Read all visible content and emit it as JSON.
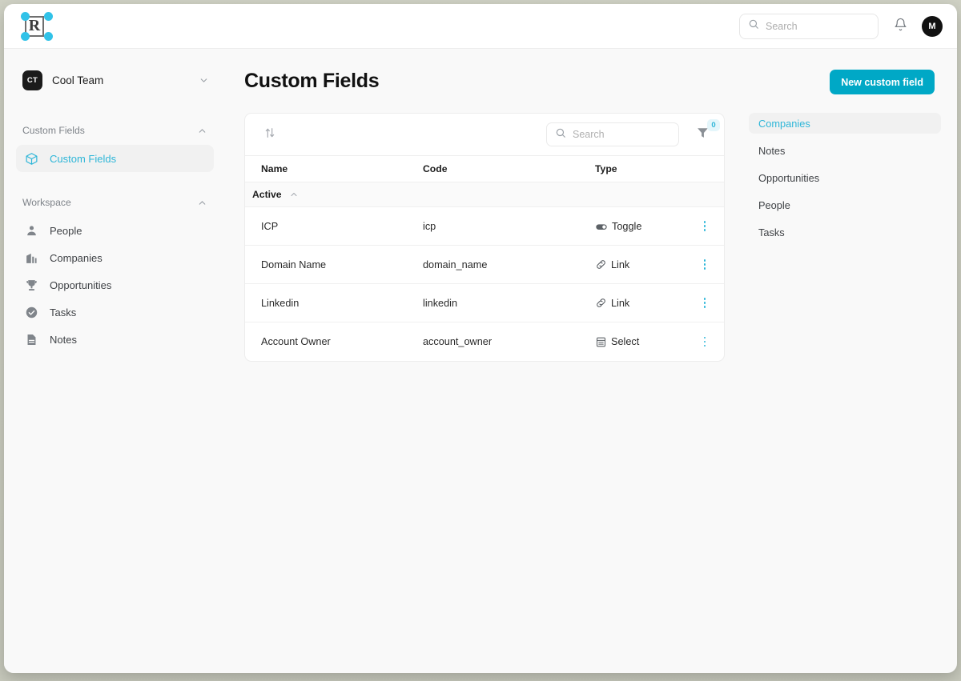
{
  "topbar": {
    "logo_letter": "R",
    "search": {
      "placeholder": "Search",
      "value": ""
    },
    "notification_icon": "bell-icon",
    "avatar_initial": "M"
  },
  "sidebar": {
    "workspace": {
      "badge": "CT",
      "name": "Cool Team"
    },
    "sections": [
      {
        "title": "Custom Fields",
        "items": [
          {
            "label": "Custom Fields",
            "icon": "cube-icon",
            "active": true
          }
        ]
      },
      {
        "title": "Workspace",
        "items": [
          {
            "label": "People",
            "icon": "person-icon",
            "active": false
          },
          {
            "label": "Companies",
            "icon": "building-icon",
            "active": false
          },
          {
            "label": "Opportunities",
            "icon": "trophy-icon",
            "active": false
          },
          {
            "label": "Tasks",
            "icon": "check-circle-icon",
            "active": false
          },
          {
            "label": "Notes",
            "icon": "note-icon",
            "active": false
          }
        ]
      }
    ]
  },
  "main": {
    "title": "Custom Fields",
    "new_button": "New custom field",
    "toolbar": {
      "sort_icon": "sort-icon",
      "search": {
        "placeholder": "Search",
        "value": ""
      },
      "filter_icon": "filter-icon",
      "filter_count": "0"
    },
    "table": {
      "columns": [
        "Name",
        "Code",
        "Type"
      ],
      "groups": [
        {
          "label": "Active",
          "rows": [
            {
              "name": "ICP",
              "code": "icp",
              "type": "Toggle",
              "type_icon": "toggle-icon"
            },
            {
              "name": "Domain Name",
              "code": "domain_name",
              "type": "Link",
              "type_icon": "link-icon"
            },
            {
              "name": "Linkedin",
              "code": "linkedin",
              "type": "Link",
              "type_icon": "link-icon"
            },
            {
              "name": "Account Owner",
              "code": "account_owner",
              "type": "Select",
              "type_icon": "select-icon"
            }
          ]
        }
      ]
    },
    "object_list": [
      {
        "label": "Companies",
        "active": true
      },
      {
        "label": "Notes",
        "active": false
      },
      {
        "label": "Opportunities",
        "active": false
      },
      {
        "label": "People",
        "active": false
      },
      {
        "label": "Tasks",
        "active": false
      }
    ]
  },
  "colors": {
    "accent": "#2eb6d8",
    "primary_button": "#00a8c6",
    "badge_bg": "#e4f6fb",
    "page_bg": "#f9f9f9"
  }
}
